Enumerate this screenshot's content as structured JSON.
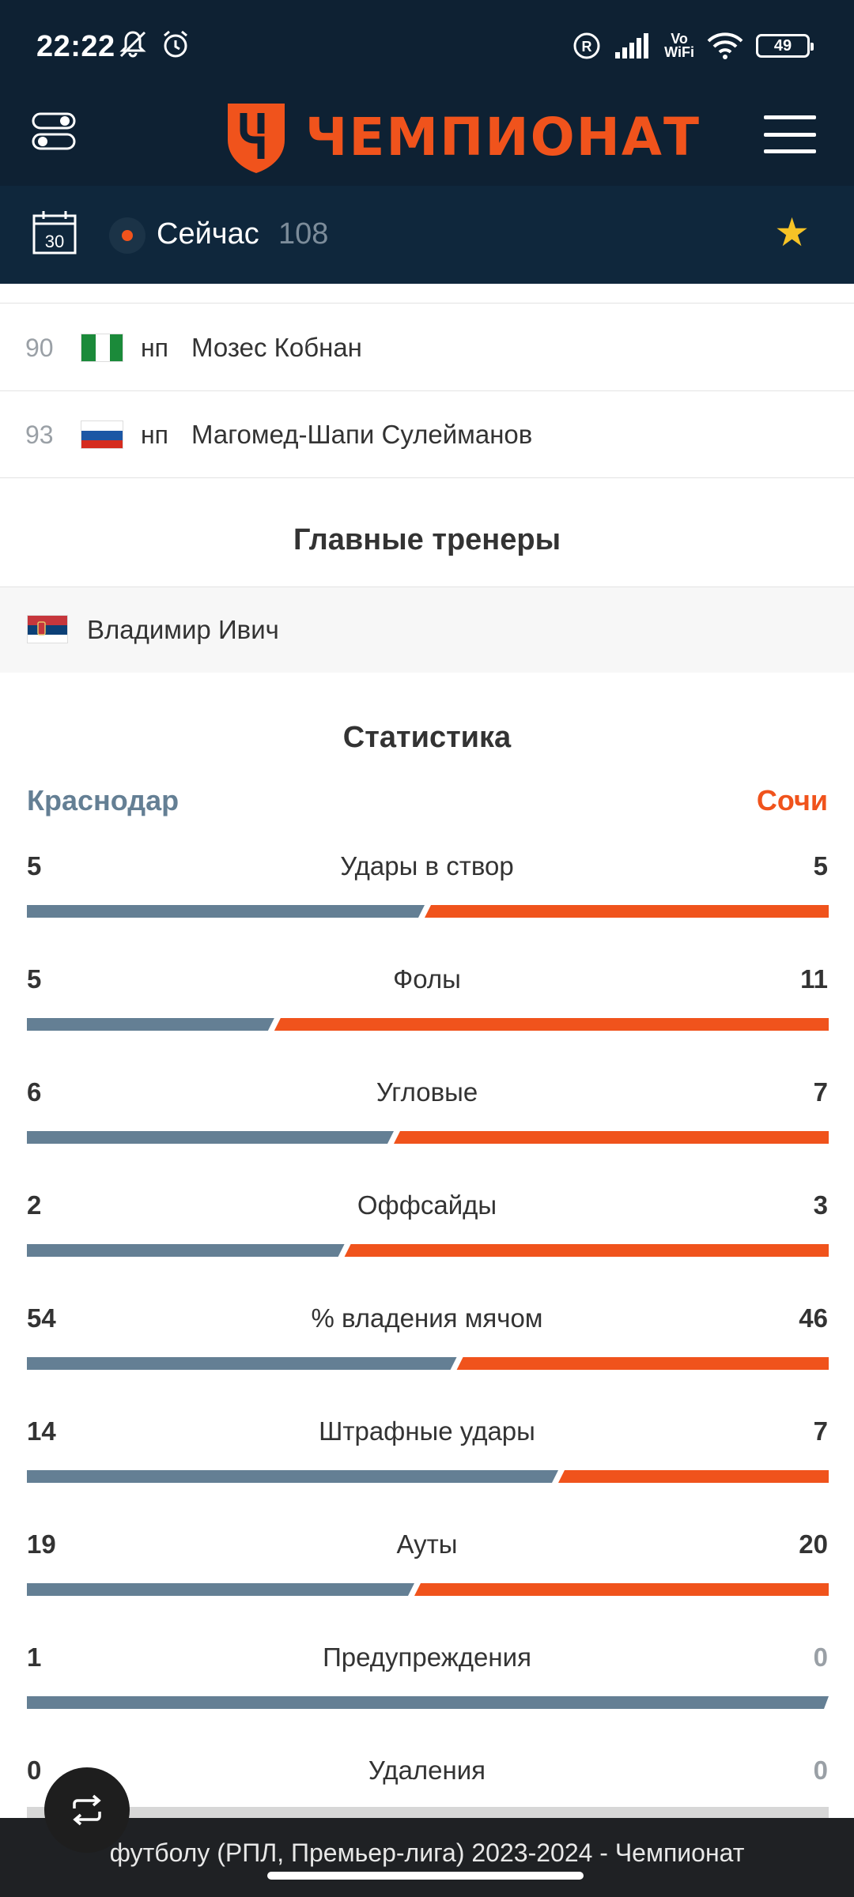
{
  "status_bar": {
    "time": "22:22",
    "battery": "49",
    "vowifi": "Vo\nWiFi"
  },
  "header": {
    "logo_text": "ЧЕМПИОНАТ",
    "brand_color": "#f0531c"
  },
  "sub_header": {
    "calendar_day": "30",
    "now_label": "Сейчас",
    "now_count": "108"
  },
  "players": [
    {
      "number": "90",
      "flag": "nigeria",
      "role": "нп",
      "name": "Мозес Кобнан"
    },
    {
      "number": "93",
      "flag": "russia",
      "role": "нп",
      "name": "Магомед-Шапи Сулейманов"
    }
  ],
  "coaches": {
    "title": "Главные тренеры",
    "items": [
      {
        "flag": "serbia",
        "name": "Владимир Ивич"
      }
    ]
  },
  "statistics": {
    "title": "Статистика",
    "home_team": "Краснодар",
    "away_team": "Сочи",
    "home_color": "#647f94",
    "away_color": "#f0531c",
    "rows": [
      {
        "label": "Удары в створ",
        "home": "5",
        "away": "5"
      },
      {
        "label": "Фолы",
        "home": "5",
        "away": "11"
      },
      {
        "label": "Угловые",
        "home": "6",
        "away": "7"
      },
      {
        "label": "Оффсайды",
        "home": "2",
        "away": "3"
      },
      {
        "label": "% владения мячом",
        "home": "54",
        "away": "46"
      },
      {
        "label": "Штрафные удары",
        "home": "14",
        "away": "7"
      },
      {
        "label": "Ауты",
        "home": "19",
        "away": "20"
      },
      {
        "label": "Предупреждения",
        "home": "1",
        "away": "0"
      },
      {
        "label": "Удаления",
        "home": "0",
        "away": "0"
      }
    ]
  },
  "bottom_bar": {
    "title": "футболу (РПЛ, Премьер-лига) 2023-2024 - Чемпионат"
  }
}
